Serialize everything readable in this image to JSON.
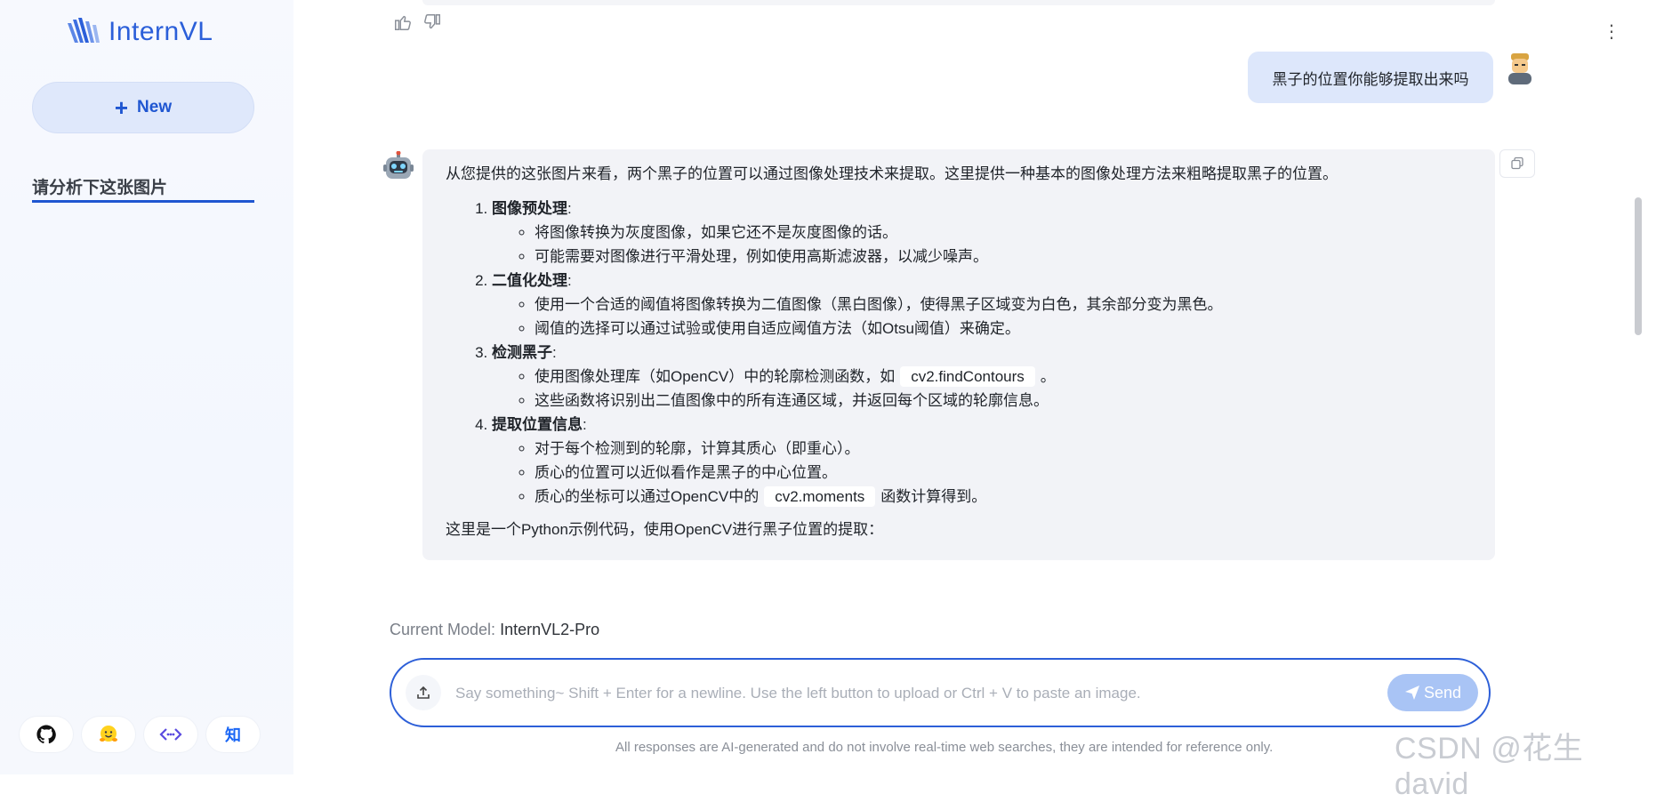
{
  "app": {
    "name": "InternVL"
  },
  "sidebar": {
    "new_label": "New",
    "chats": [
      {
        "title": "请分析下这张图片"
      }
    ],
    "footer_icons": [
      "github-icon",
      "huggingface-icon",
      "code-icon",
      "zhihu-icon"
    ],
    "zhihu_glyph": "知"
  },
  "conversation": {
    "user_message": "黑子的位置你能够提取出来吗",
    "assistant": {
      "intro": "从您提供的这张图片来看，两个黑子的位置可以通过图像处理技术来提取。这里提供一种基本的图像处理方法来粗略提取黑子的位置。",
      "steps": [
        {
          "title": "图像预处理",
          "colon": ":",
          "points": [
            "将图像转换为灰度图像，如果它还不是灰度图像的话。",
            "可能需要对图像进行平滑处理，例如使用高斯滤波器，以减少噪声。"
          ]
        },
        {
          "title": "二值化处理",
          "colon": ":",
          "points": [
            "使用一个合适的阈值将图像转换为二值图像（黑白图像），使得黑子区域变为白色，其余部分变为黑色。",
            "阈值的选择可以通过试验或使用自适应阈值方法（如Otsu阈值）来确定。"
          ]
        },
        {
          "title": "检测黑子",
          "colon": ":",
          "points_special": {
            "p1_before": "使用图像处理库（如OpenCV）中的轮廓检测函数，如",
            "p1_code": "cv2.findContours",
            "p1_after": "。",
            "p2": "这些函数将识别出二值图像中的所有连通区域，并返回每个区域的轮廓信息。"
          }
        },
        {
          "title": "提取位置信息",
          "colon": ":",
          "points_special": {
            "p1": "对于每个检测到的轮廓，计算其质心（即重心）。",
            "p2": "质心的位置可以近似看作是黑子的中心位置。",
            "p3_before": "质心的坐标可以通过OpenCV中的",
            "p3_code": "cv2.moments",
            "p3_after": "函数计算得到。"
          }
        }
      ],
      "outro": "这里是一个Python示例代码，使用OpenCV进行黑子位置的提取："
    }
  },
  "model": {
    "label": "Current Model:",
    "value": "InternVL2-Pro"
  },
  "input": {
    "placeholder": "Say something~ Shift + Enter for a newline. Use the left button to upload or Ctrl + V to paste an image.",
    "send_label": "Send"
  },
  "disclaimer": "All responses are AI-generated and do not involve real-time web searches, they are intended for reference only.",
  "watermark": "CSDN @花生david",
  "colors": {
    "accent": "#2d5fd8",
    "user_bubble": "#dde7fb",
    "bot_bubble": "#f2f3f7",
    "send_disabled": "#a9c4f5"
  }
}
